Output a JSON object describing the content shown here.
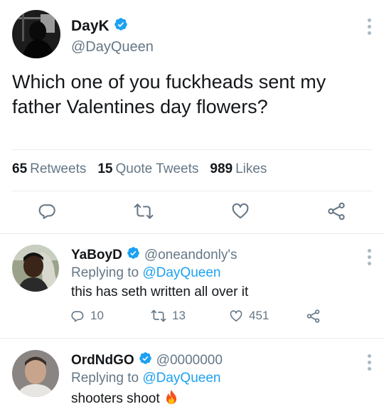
{
  "main_tweet": {
    "display_name": "DayK",
    "handle": "@DayQueen",
    "text": "Which one of you fuckheads sent my father Valentines day flowers?",
    "stats": {
      "retweets_count": "65",
      "retweets_label": "Retweets",
      "quotes_count": "15",
      "quotes_label": "Quote Tweets",
      "likes_count": "989",
      "likes_label": "Likes"
    },
    "actions": [
      "reply-icon",
      "retweet-icon",
      "like-icon",
      "share-icon"
    ]
  },
  "replies": [
    {
      "display_name": "YaBoyD",
      "handle": "@oneandonly's",
      "replying_prefix": "Replying to",
      "replying_to": "@DayQueen",
      "text": "this has seth written all over it",
      "replies": "10",
      "retweets": "13",
      "likes": "451"
    },
    {
      "display_name": "OrdNdGO",
      "handle": "@0000000",
      "replying_prefix": "Replying to",
      "replying_to": "@DayQueen",
      "text": "shooters shoot",
      "emoji_icon": "fire-emoji-icon"
    }
  ],
  "colors": {
    "accent": "#1da1f2",
    "secondary_text": "#657786",
    "verified": "#1da1f2",
    "divider": "#e6ecf0"
  }
}
